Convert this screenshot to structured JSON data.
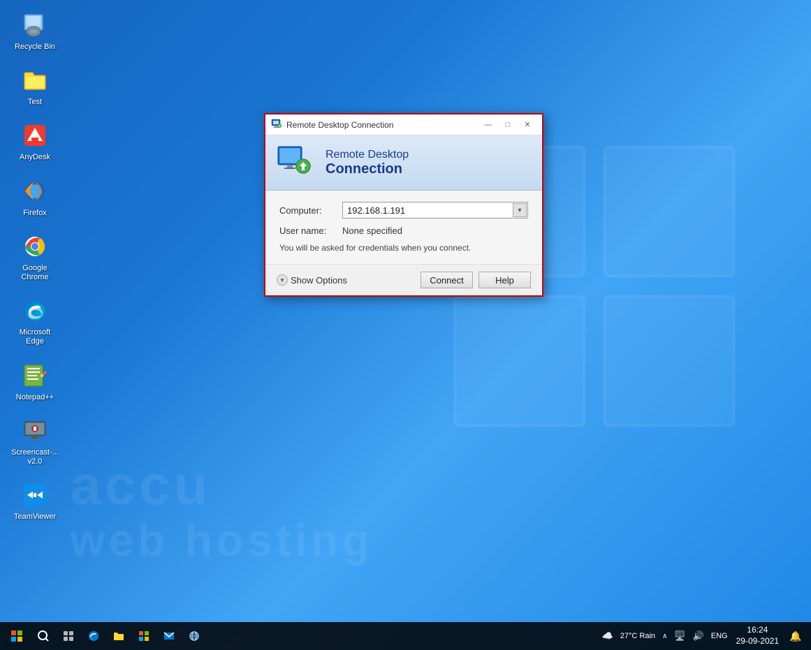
{
  "desktop": {
    "icons": [
      {
        "id": "recycle-bin",
        "label": "Recycle Bin",
        "emoji": "🗑️"
      },
      {
        "id": "test",
        "label": "Test",
        "emoji": "📁"
      },
      {
        "id": "anydesk",
        "label": "AnyDesk",
        "emoji": "🟥"
      },
      {
        "id": "firefox",
        "label": "Firefox",
        "emoji": "🦊"
      },
      {
        "id": "google-chrome",
        "label": "Google Chrome",
        "emoji": "🔵"
      },
      {
        "id": "microsoft-edge",
        "label": "Microsoft Edge",
        "emoji": "🌀"
      },
      {
        "id": "notepadpp",
        "label": "Notepad++",
        "emoji": "📝"
      },
      {
        "id": "screencast",
        "label": "Screencast-... v2.0",
        "emoji": "🖥️"
      },
      {
        "id": "teamviewer",
        "label": "TeamViewer",
        "emoji": "↔️"
      }
    ],
    "watermark_line1": "accu",
    "watermark_line2": "web hosting"
  },
  "rdp_dialog": {
    "title": "Remote Desktop Connection",
    "header_line1": "Remote Desktop",
    "header_line2": "Connection",
    "computer_label": "Computer:",
    "computer_value": "192.168.1.191",
    "username_label": "User name:",
    "username_value": "None specified",
    "hint_text": "You will be asked for credentials when you connect.",
    "show_options_label": "Show Options",
    "connect_label": "Connect",
    "help_label": "Help",
    "window_controls": {
      "minimize": "—",
      "maximize": "□",
      "close": "✕"
    }
  },
  "taskbar": {
    "start_icon": "⊞",
    "search_icon": "○",
    "task_view": "⧉",
    "pinned": [
      "🗔",
      "🌀",
      "📁",
      "🪟",
      "✉️",
      "🌐"
    ],
    "weather": "27°C Rain",
    "sys_icons": [
      "∧",
      "🔊",
      "ENG"
    ],
    "time": "16:24",
    "date": "29-09-2021",
    "notification_icon": "🔔"
  }
}
